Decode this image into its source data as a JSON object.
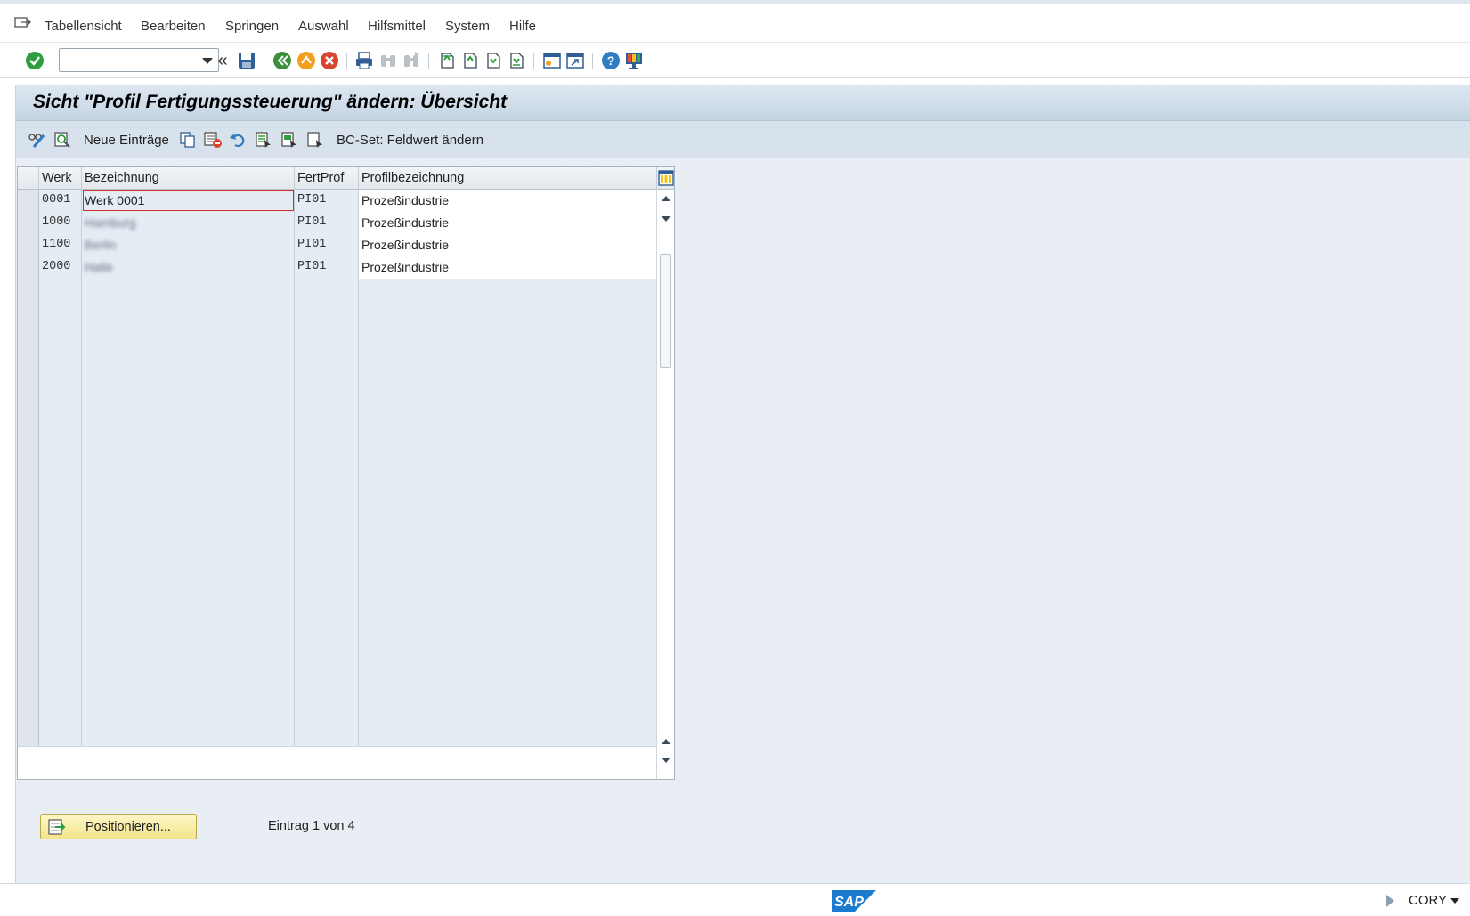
{
  "menubar": {
    "items": [
      {
        "label": "Tabellensicht"
      },
      {
        "label": "Bearbeiten"
      },
      {
        "label": "Springen"
      },
      {
        "label": "Auswahl"
      },
      {
        "label": "Hilfsmittel"
      },
      {
        "label": "System"
      },
      {
        "label": "Hilfe"
      }
    ]
  },
  "toolbar": {
    "command_field_value": ""
  },
  "title": "Sicht \"Profil Fertigungssteuerung\" ändern: Übersicht",
  "app_toolbar": {
    "new_entries_label": "Neue Einträge",
    "bcset_label": "BC-Set: Feldwert ändern"
  },
  "table": {
    "columns": [
      "Werk",
      "Bezeichnung",
      "FertProf",
      "Profilbezeichnung"
    ],
    "rows": [
      {
        "werk": "0001",
        "bezeichnung": "Werk 0001",
        "fertprof": "PI01",
        "profil": "Prozeßindustrie"
      },
      {
        "werk": "1000",
        "bezeichnung": "Hamburg",
        "fertprof": "PI01",
        "profil": "Prozeßindustrie"
      },
      {
        "werk": "1100",
        "bezeichnung": "Berlin",
        "fertprof": "PI01",
        "profil": "Prozeßindustrie"
      },
      {
        "werk": "2000",
        "bezeichnung": "Halle",
        "fertprof": "PI01",
        "profil": "Prozeßindustrie"
      }
    ]
  },
  "footer": {
    "position_button_label": "Positionieren...",
    "entry_info": "Eintrag 1 von 4"
  },
  "statusbar": {
    "logo_text": "SAP",
    "system_name": "CORY"
  },
  "colors": {
    "accept_green": "#2e9e3e",
    "back_green": "#3c8f3a",
    "exit_orange": "#f0a01e",
    "cancel_red": "#d9442e",
    "sap_blue": "#1b7ccf"
  }
}
